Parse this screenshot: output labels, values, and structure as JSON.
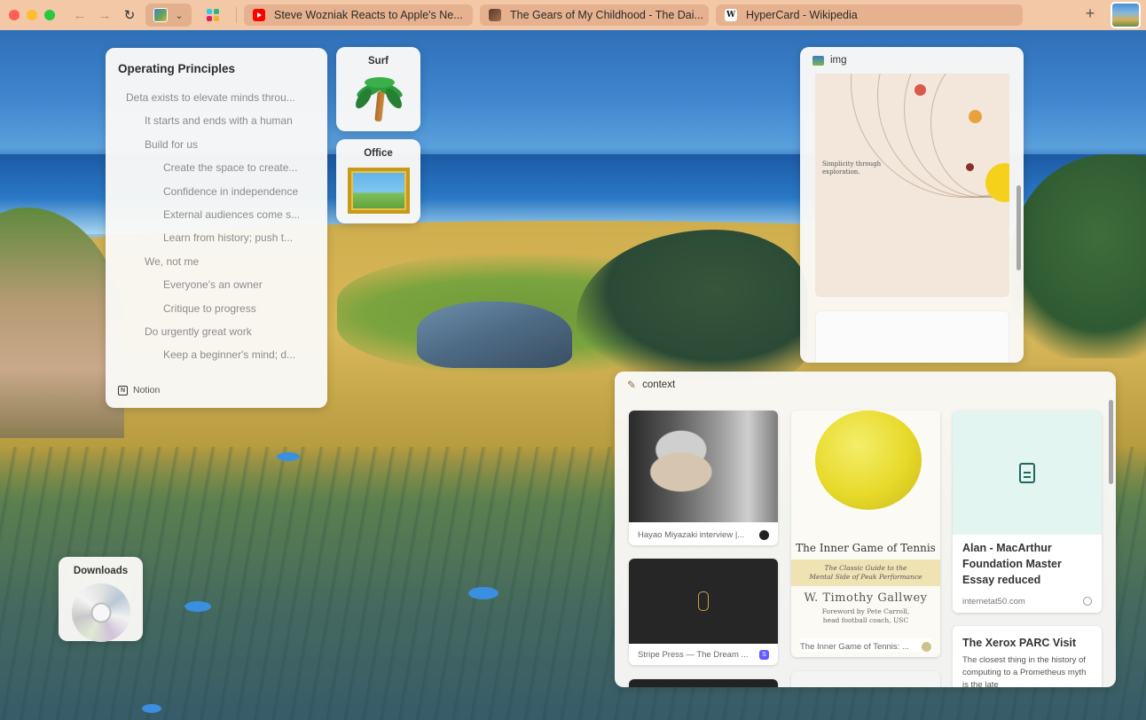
{
  "browser": {
    "tabs": [
      {
        "title": "Steve Wozniak Reacts to Apple's Ne...",
        "favicon": "youtube-icon"
      },
      {
        "title": "The Gears of My Childhood - The Dai...",
        "favicon": "page-thumbnail-icon"
      },
      {
        "title": "HyperCard - Wikipedia",
        "favicon": "wikipedia-icon"
      }
    ],
    "wiki_glyph": "W",
    "new_tab_symbol": "+",
    "nav": {
      "back": "←",
      "forward": "→",
      "reload": "↻"
    },
    "caret": "⌄",
    "accent_color": "#f3c8a6"
  },
  "notion": {
    "title": "Operating Principles",
    "items": [
      {
        "text": "Deta exists to elevate minds throu...",
        "level": 0
      },
      {
        "text": "It starts and ends with a human",
        "level": 1
      },
      {
        "text": "Build for us",
        "level": 1
      },
      {
        "text": "Create the space to create...",
        "level": 2
      },
      {
        "text": "Confidence in independence",
        "level": 2
      },
      {
        "text": "External audiences come s...",
        "level": 2
      },
      {
        "text": "Learn from history; push t...",
        "level": 2
      },
      {
        "text": "We, not me",
        "level": 1
      },
      {
        "text": "Everyone's an owner",
        "level": 2
      },
      {
        "text": "Critique to progress",
        "level": 2
      },
      {
        "text": "Do urgently great work",
        "level": 1
      },
      {
        "text": "Keep a beginner's mind; d...",
        "level": 2
      }
    ],
    "source_label": "Notion",
    "logo_letter": "N"
  },
  "tiles": {
    "surf": "Surf",
    "office": "Office",
    "downloads": "Downloads"
  },
  "img_panel": {
    "title": "img",
    "poster_text": "Simplicity through\nexploration."
  },
  "context_panel": {
    "title": "context",
    "cards": {
      "miyazaki": {
        "caption": "Hayao Miyazaki interview |..."
      },
      "stripe": {
        "caption": "Stripe Press — The Dream ...",
        "badge": "S"
      },
      "tennis": {
        "caption": "The Inner Game of Tennis: ...",
        "book_title": "The Inner Game of Tennis",
        "book_subtitle": "The Classic Guide to the\nMental Side of Peak Performance",
        "book_author": "W. Timothy Gallwey",
        "book_foreword": "Foreword by Pete Carroll,\nhead football coach, USC"
      },
      "alan": {
        "title": "Alan - MacArthur Foundation Master Essay reduced",
        "url": "internetat50.com"
      },
      "xerox": {
        "title": "The Xerox PARC Visit",
        "body": "The closest thing in the history of computing to a Prometheus myth is the late"
      }
    }
  }
}
